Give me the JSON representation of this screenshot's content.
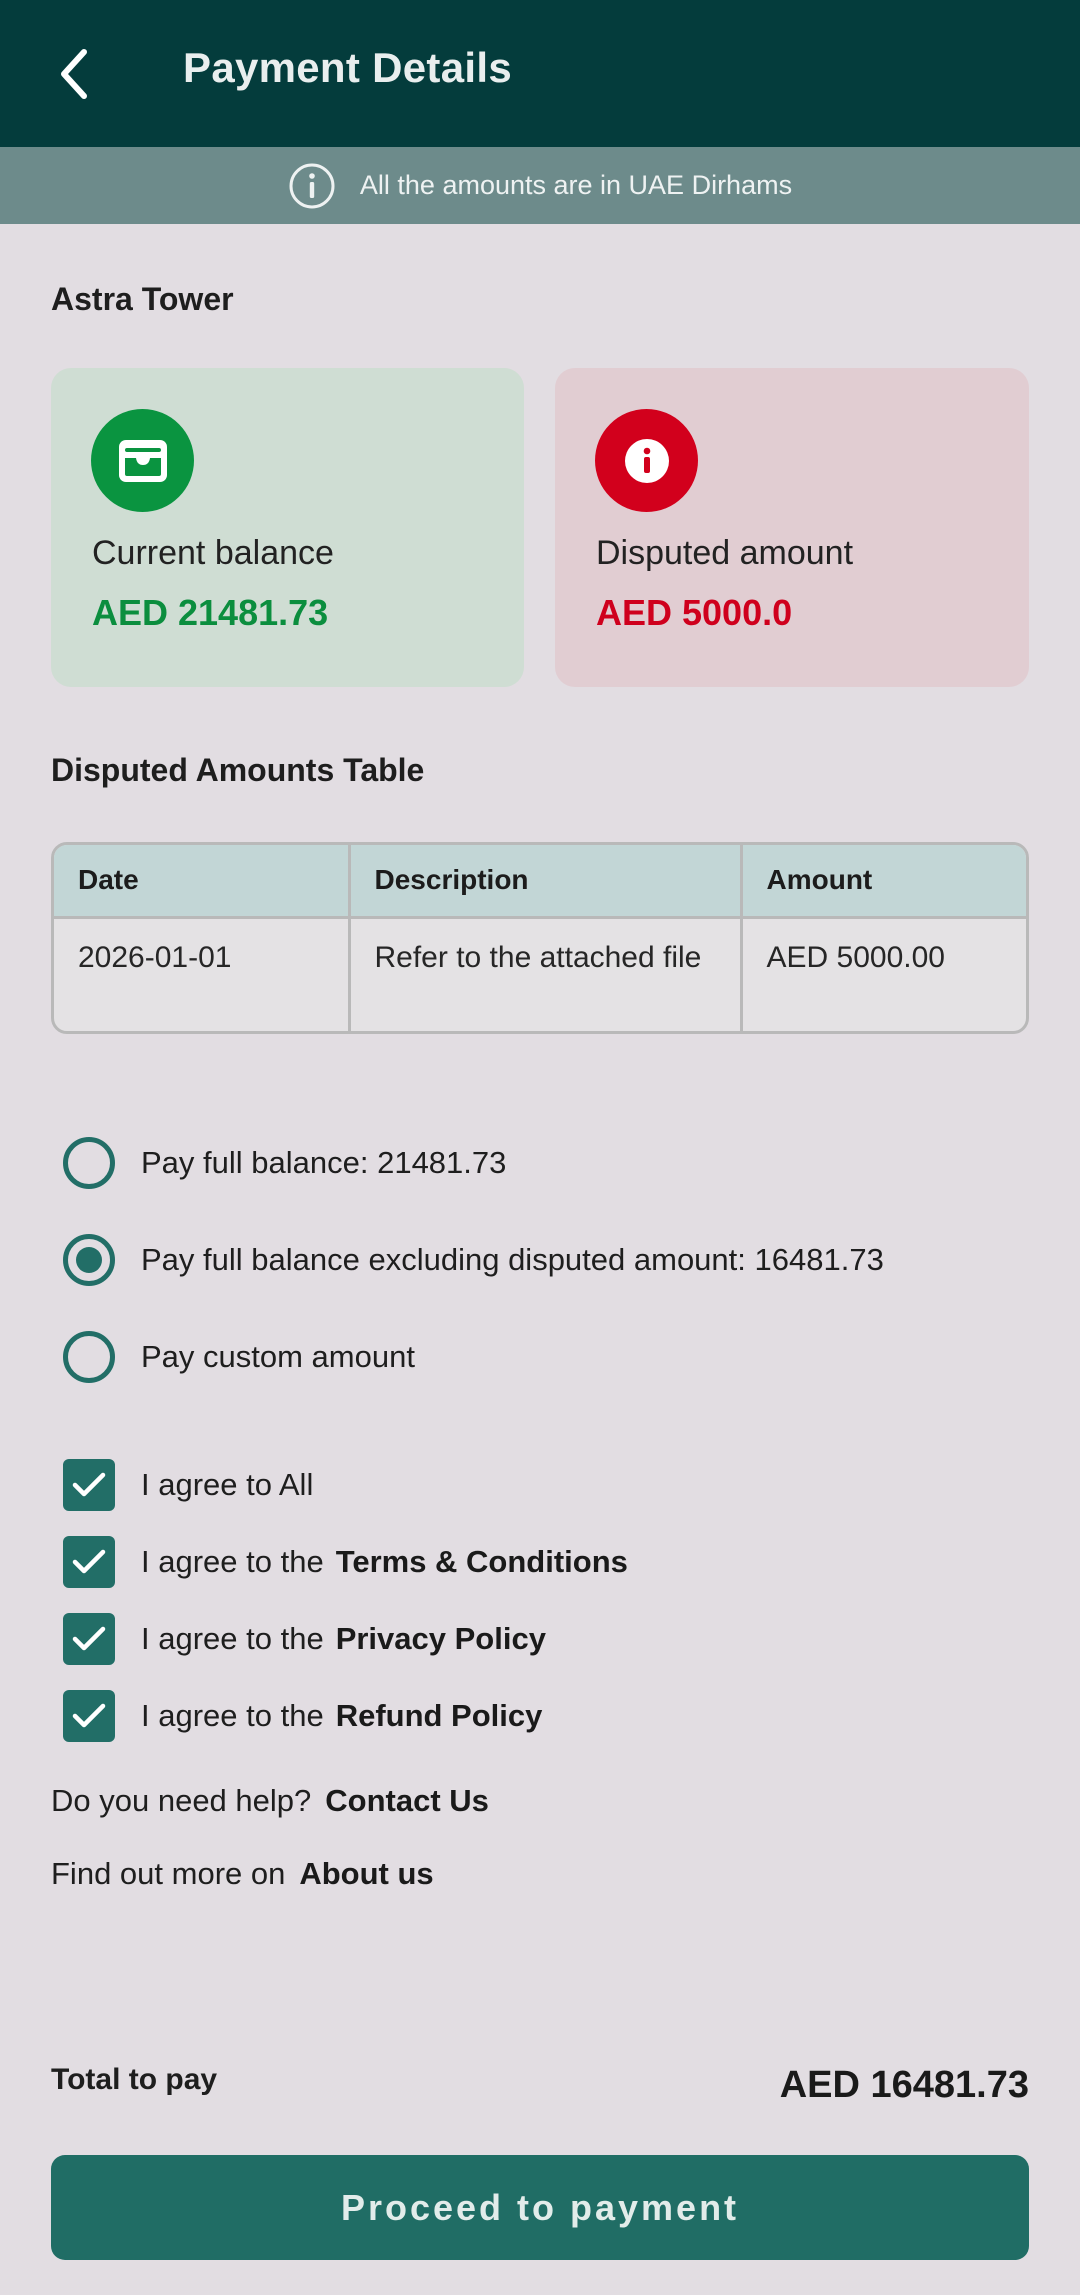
{
  "header": {
    "title": "Payment Details",
    "back_icon": "chevron-left-icon"
  },
  "banner": {
    "text": "All the amounts are in UAE Dirhams",
    "icon": "info-icon"
  },
  "property": {
    "name": "Astra Tower"
  },
  "cards": {
    "balance": {
      "label": "Current balance",
      "value": "AED 21481.73",
      "icon": "wallet-icon",
      "color": "#0b8e3e"
    },
    "disputed": {
      "label": "Disputed amount",
      "value": "AED 5000.0",
      "icon": "info-icon",
      "color": "#cf001d"
    }
  },
  "disputed_table": {
    "title": "Disputed Amounts Table",
    "columns": [
      "Date",
      "Description",
      "Amount"
    ],
    "rows": [
      [
        "2026-01-01",
        "Refer to the attached file",
        "AED 5000.00"
      ]
    ]
  },
  "payment_options": [
    {
      "label": "Pay full balance: 21481.73",
      "selected": false
    },
    {
      "label": "Pay full balance excluding disputed amount: 16481.73",
      "selected": true
    },
    {
      "label": "Pay custom amount",
      "selected": false
    }
  ],
  "agreements": {
    "all_label": "I agree to All",
    "prefix": "I agree to the",
    "items": [
      {
        "link": "Terms & Conditions",
        "checked": true
      },
      {
        "link": "Privacy Policy",
        "checked": true
      },
      {
        "link": "Refund Policy",
        "checked": true
      }
    ],
    "all_checked": true
  },
  "help": {
    "question": "Do you need help?",
    "contact_link": "Contact Us",
    "more_text": "Find out more on",
    "about_link": "About us"
  },
  "total": {
    "label": "Total to pay",
    "value": "AED 16481.73"
  },
  "proceed_button": {
    "label": "Proceed to payment",
    "color": "#206d65"
  }
}
